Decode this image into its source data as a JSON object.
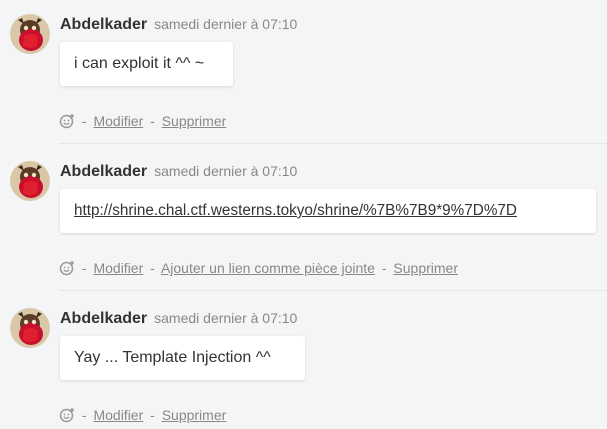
{
  "comments": [
    {
      "author": "Abdelkader",
      "time": "samedi dernier à 07:10",
      "message": "i can exploit it ^^ ~",
      "actions": [
        "Modifier",
        "Supprimer"
      ]
    },
    {
      "author": "Abdelkader",
      "time": "samedi dernier à 07:10",
      "message": "http://shrine.chal.ctf.westerns.tokyo/shrine/%7B%7B9*9%7D%7D",
      "actions": [
        "Modifier",
        "Ajouter un lien comme pièce jointe",
        "Supprimer"
      ]
    },
    {
      "author": "Abdelkader",
      "time": "samedi dernier à 07:10",
      "message": "Yay ... Template Injection ^^",
      "actions": [
        "Modifier",
        "Supprimer"
      ]
    }
  ],
  "separator": "-",
  "icons": {
    "avatar": "avatar-image",
    "reaction": "add-reaction-icon"
  },
  "colors": {
    "background": "#f4f5f7",
    "author": "#333333",
    "meta": "#888888",
    "bubble": "#ffffff"
  }
}
